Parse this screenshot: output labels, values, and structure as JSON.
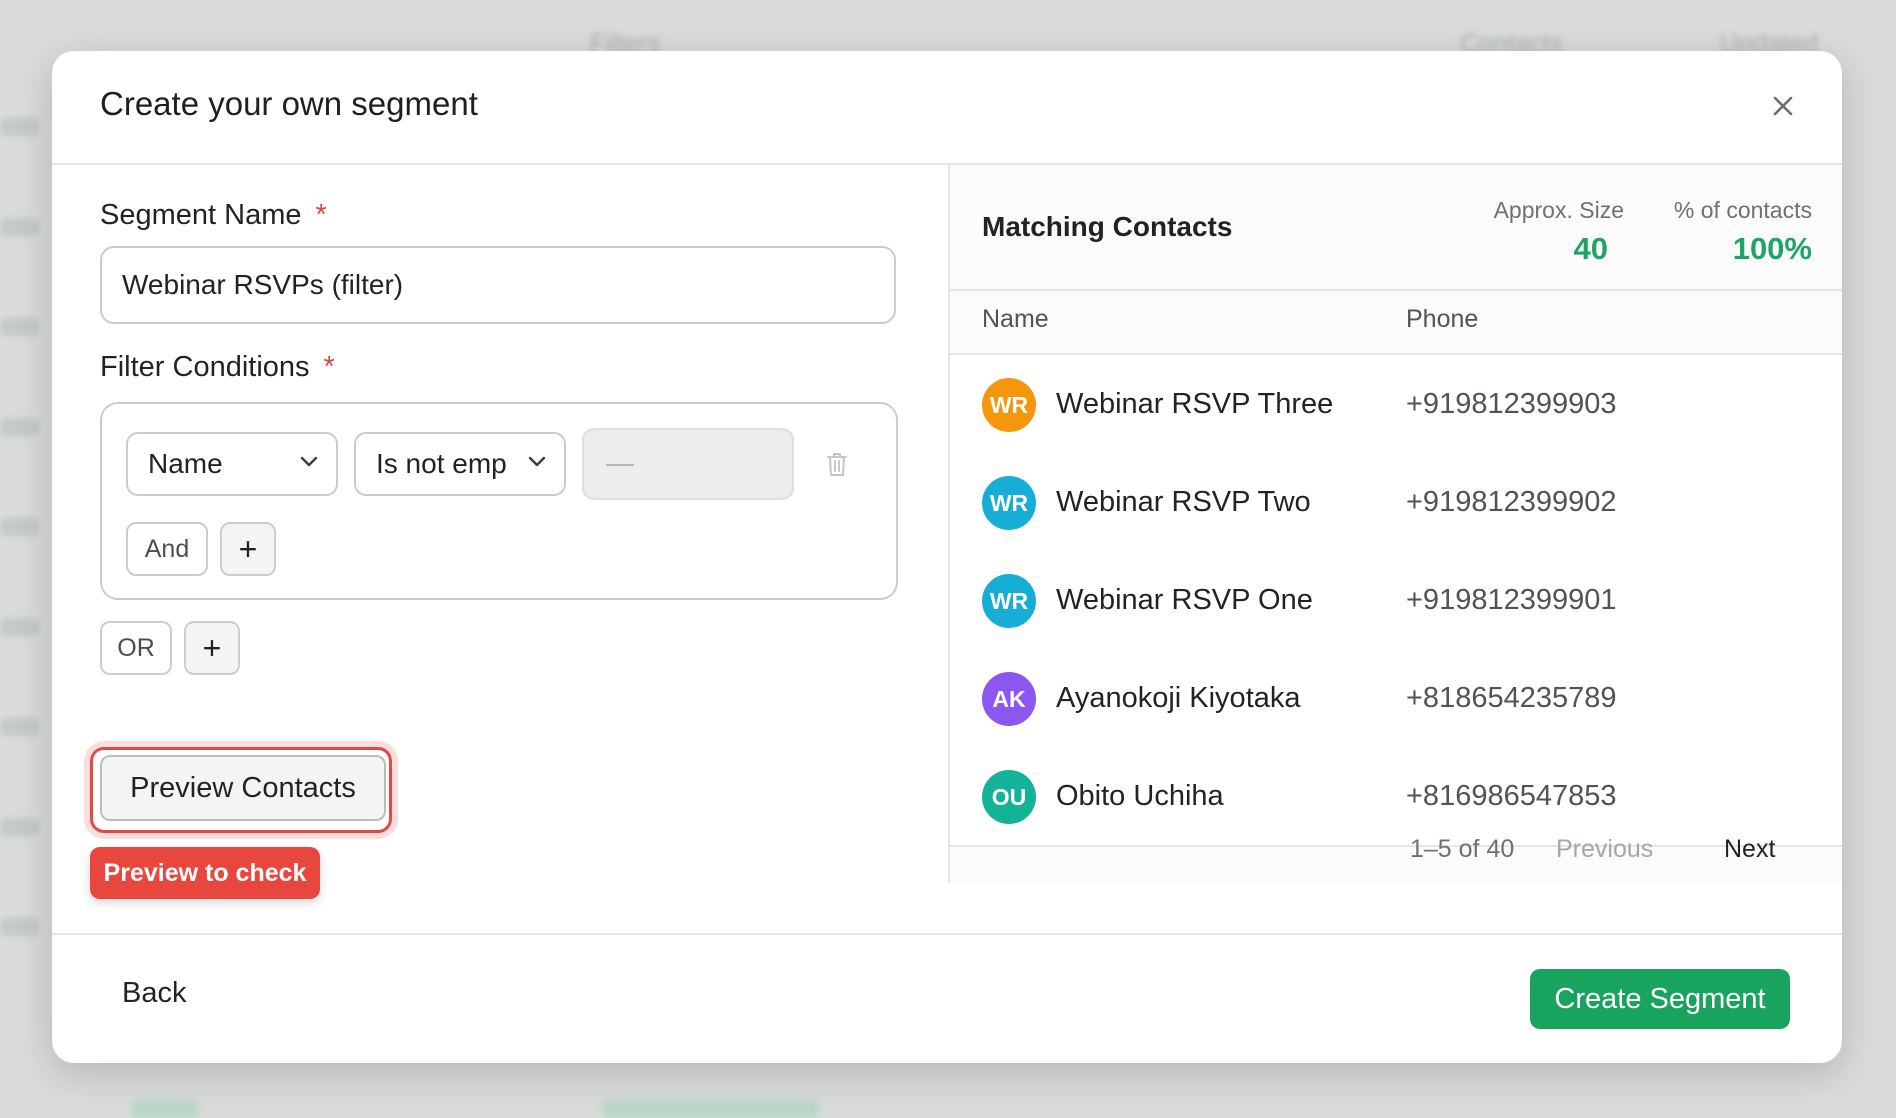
{
  "modal": {
    "title": "Create your own segment",
    "close_icon": "close-icon"
  },
  "form": {
    "segment_name_label": "Segment Name",
    "required_mark": "*",
    "segment_name_value": "Webinar RSVPs (filter)",
    "filter_conditions_label": "Filter Conditions",
    "condition": {
      "field": "Name",
      "operator": "Is not emp",
      "value_placeholder": "—"
    },
    "and_label": "And",
    "add_label": "+",
    "or_label": "OR",
    "preview_label": "Preview Contacts",
    "tooltip": "Preview to check"
  },
  "matching": {
    "title": "Matching Contacts",
    "approx_size_label": "Approx. Size",
    "approx_size_value": "40",
    "percent_label": "% of contacts",
    "percent_value": "100%",
    "columns": [
      "Name",
      "Phone"
    ],
    "contacts": [
      {
        "initials": "WR",
        "name": "Webinar RSVP Three",
        "phone": "+919812399903",
        "color": "#f5960c"
      },
      {
        "initials": "WR",
        "name": "Webinar RSVP Two",
        "phone": "+919812399902",
        "color": "#16aed6"
      },
      {
        "initials": "WR",
        "name": "Webinar RSVP One",
        "phone": "+919812399901",
        "color": "#16aed6"
      },
      {
        "initials": "AK",
        "name": "Ayanokoji Kiyotaka",
        "phone": "+818654235789",
        "color": "#8b57f0"
      },
      {
        "initials": "OU",
        "name": "Obito Uchiha",
        "phone": "+816986547853",
        "color": "#13b39a"
      }
    ],
    "pager": {
      "count": "1–5 of 40",
      "previous": "Previous",
      "next": "Next"
    }
  },
  "footer": {
    "back_label": "Back",
    "create_label": "Create Segment"
  },
  "background": {
    "headers": [
      "Filters",
      "Contacts",
      "Updated"
    ]
  },
  "colors": {
    "accent_green": "#18a35f",
    "danger_red": "#e8473f"
  }
}
